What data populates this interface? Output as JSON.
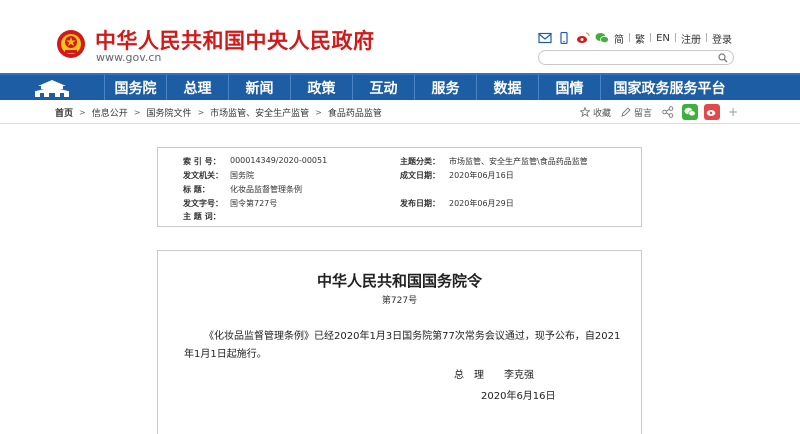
{
  "header": {
    "site_title": "中华人民共和国中央人民政府",
    "site_url": "www.gov.cn",
    "links": [
      "简",
      "繁",
      "EN",
      "注册",
      "登录"
    ],
    "search_placeholder": ""
  },
  "nav": {
    "items": [
      "国务院",
      "总理",
      "新闻",
      "政策",
      "互动",
      "服务",
      "数据",
      "国情",
      "国家政务服务平台"
    ]
  },
  "breadcrumb": {
    "items": [
      "首页",
      "信息公开",
      "国务院文件",
      "市场监管、安全生产监管",
      "食品药品监管"
    ]
  },
  "tools": {
    "favorite": "收藏",
    "comment": "留言"
  },
  "info": {
    "index_label": "索  引  号：",
    "index_value": "000014349/2020-00051",
    "category_label": "主题分类：",
    "category_value": "市场监管、安全生产监管\\食品药品监管",
    "issuer_label": "发文机关：",
    "issuer_value": "国务院",
    "created_label": "成文日期：",
    "created_value": "2020年06月16日",
    "title_label": "标      题：",
    "title_value": "化妆品监督管理条例",
    "docno_label": "发文字号：",
    "docno_value": "国令第727号",
    "published_label": "发布日期：",
    "published_value": "2020年06月29日",
    "keywords_label": "主  题  词："
  },
  "document": {
    "title": "中华人民共和国国务院令",
    "number": "第727号",
    "paragraph": "《化妆品监督管理条例》已经2020年1月3日国务院第77次常务会议通过，现予公布，自2021年1月1日起施行。",
    "signature": "总　理　　李克强",
    "date": "2020年6月16日"
  },
  "colors": {
    "title_red": "#d2191a",
    "nav_blue": "#1c5da4"
  }
}
